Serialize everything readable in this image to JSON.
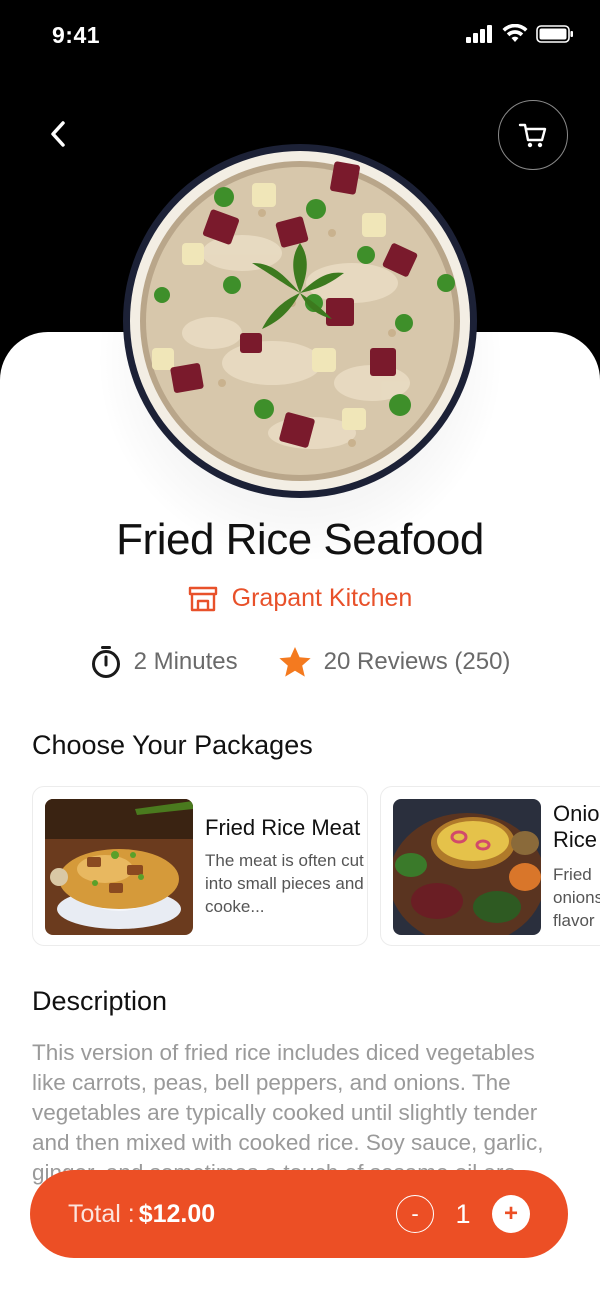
{
  "status_bar": {
    "time": "9:41"
  },
  "header": {
    "back_icon": "chevron-left-icon",
    "cart_icon": "cart-icon"
  },
  "dish": {
    "title": "Fried Rice Seafood",
    "kitchen": "Grapant Kitchen",
    "kitchen_icon": "store-icon",
    "time": "2 Minutes",
    "time_icon": "stopwatch-icon",
    "reviews": "20 Reviews (250)",
    "reviews_icon": "star-icon"
  },
  "packages": {
    "title": "Choose Your Packages",
    "items": [
      {
        "name": "Fried Rice Meat",
        "description": "The meat is often cut into small pieces and cooke..."
      },
      {
        "name": "Onion Rice",
        "description": "Fried onions flavor"
      }
    ]
  },
  "description": {
    "title": "Description",
    "text": "This version of fried rice includes diced vegetables like carrots, peas, bell peppers, and onions. The vegetables are typically cooked until slightly tender and then mixed with cooked rice. Soy sauce, garlic, ginger, and sometimes a touch of sesame oil are"
  },
  "cart_bar": {
    "total_label": "Total :",
    "total_value": "$12.00",
    "minus": "-",
    "quantity": "1",
    "plus": "+"
  },
  "colors": {
    "accent": "#ec4f25",
    "kitchen": "#e8512a",
    "star": "#f47a1f"
  }
}
